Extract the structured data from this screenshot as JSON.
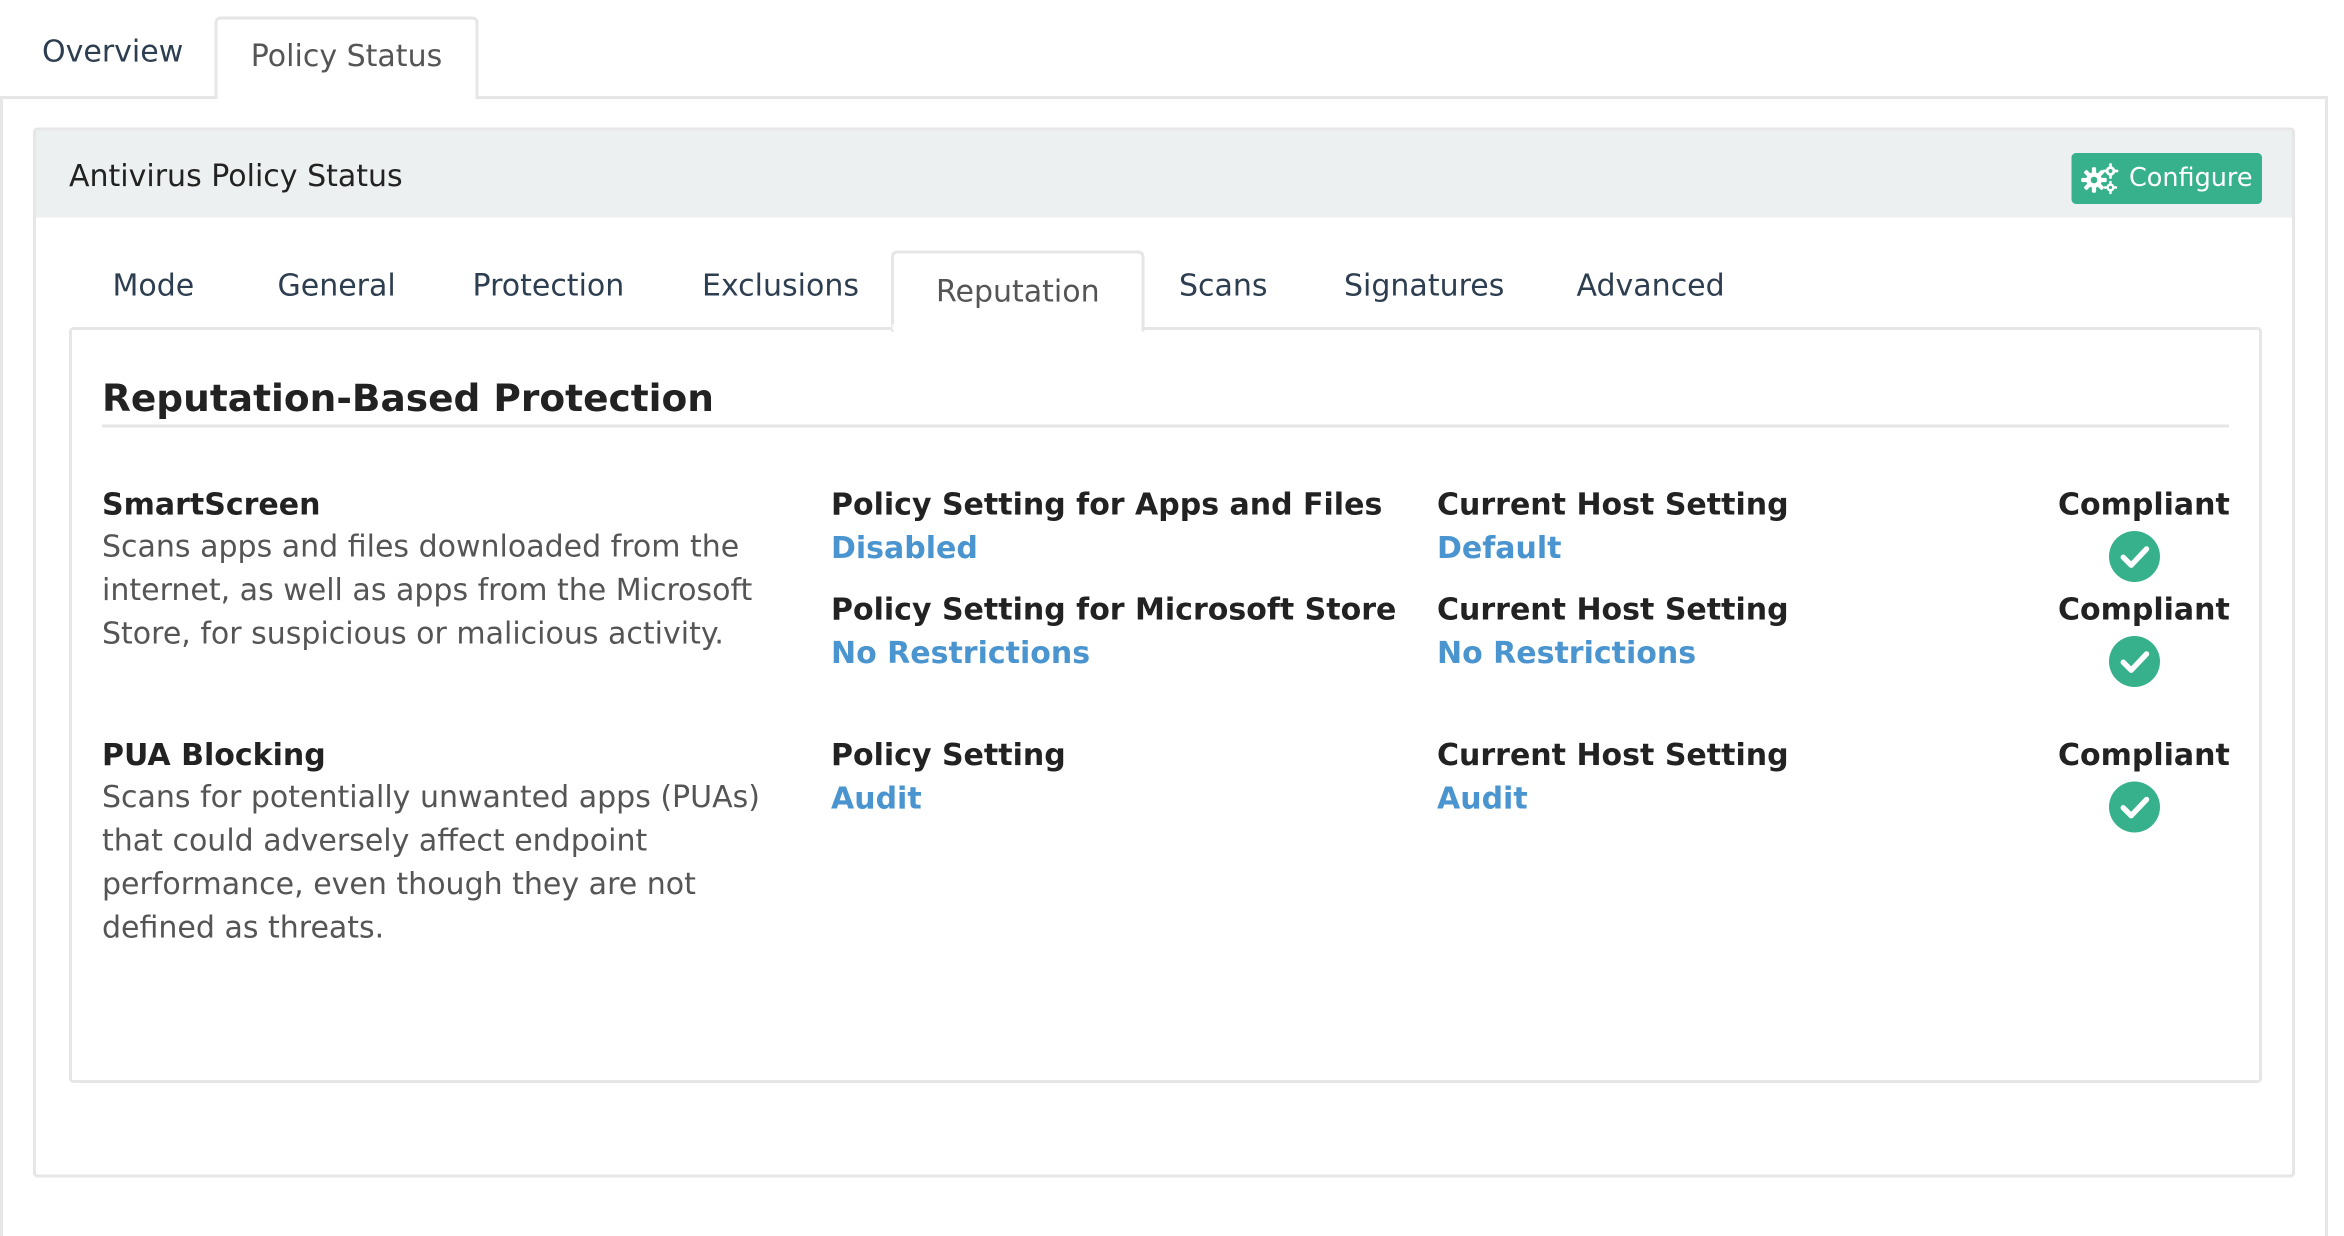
{
  "top_tabs": {
    "overview": "Overview",
    "policy_status": "Policy Status"
  },
  "card": {
    "title": "Antivirus Policy Status",
    "configure_label": "Configure"
  },
  "inner_tabs": [
    "Mode",
    "General",
    "Protection",
    "Exclusions",
    "Reputation",
    "Scans",
    "Signatures",
    "Advanced"
  ],
  "active_inner_tab": "Reputation",
  "section_title": "Reputation-Based Protection",
  "features": [
    {
      "name": "SmartScreen",
      "description": "Scans apps and files downloaded from the internet, as well as apps from the Microsoft Store, for suspicious or malicious activity.",
      "rows": [
        {
          "policy_label": "Policy Setting for Apps and Files",
          "policy_value": "Disabled",
          "host_label": "Current Host Setting",
          "host_value": "Default",
          "compliant_label": "Compliant"
        },
        {
          "policy_label": "Policy Setting for Microsoft Store",
          "policy_value": "No Restrictions",
          "host_label": "Current Host Setting",
          "host_value": "No Restrictions",
          "compliant_label": "Compliant"
        }
      ]
    },
    {
      "name": "PUA Blocking",
      "description": "Scans for potentially unwanted apps (PUAs) that could adversely affect endpoint performance, even though they are not defined as threats.",
      "rows": [
        {
          "policy_label": "Policy Setting",
          "policy_value": "Audit",
          "host_label": "Current Host Setting",
          "host_value": "Audit",
          "compliant_label": "Compliant"
        }
      ]
    }
  ],
  "icons": {
    "configure": "gears-icon",
    "compliant": "check-circle-icon"
  },
  "colors": {
    "accent_button": "#36b18b",
    "value_link": "#4a95cf",
    "check": "#36b18b"
  }
}
